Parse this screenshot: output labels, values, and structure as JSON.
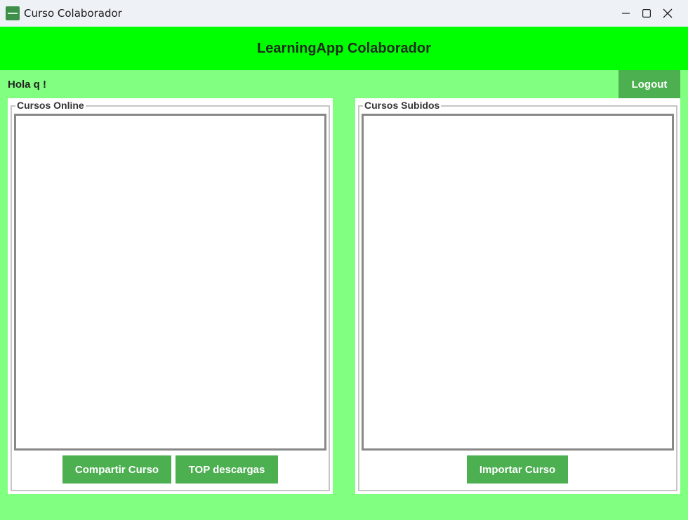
{
  "window": {
    "title": "Curso Colaborador",
    "icon": "app-icon",
    "controls": [
      "minimize-icon",
      "maximize-icon",
      "close-icon"
    ]
  },
  "header": {
    "title": "LearningApp Colaborador"
  },
  "user": {
    "greeting": "Hola q !"
  },
  "logout": {
    "label": "Logout"
  },
  "online": {
    "label": "Cursos Online",
    "items": [],
    "share_label": "Compartir Curso",
    "top_label": "TOP descargas"
  },
  "uploaded": {
    "label": "Cursos Subidos",
    "items": [],
    "import_label": "Importar Curso"
  },
  "colors": {
    "header_bg": "#00ff00",
    "body_bg": "#80ff80",
    "button_bg": "#4caf50"
  }
}
